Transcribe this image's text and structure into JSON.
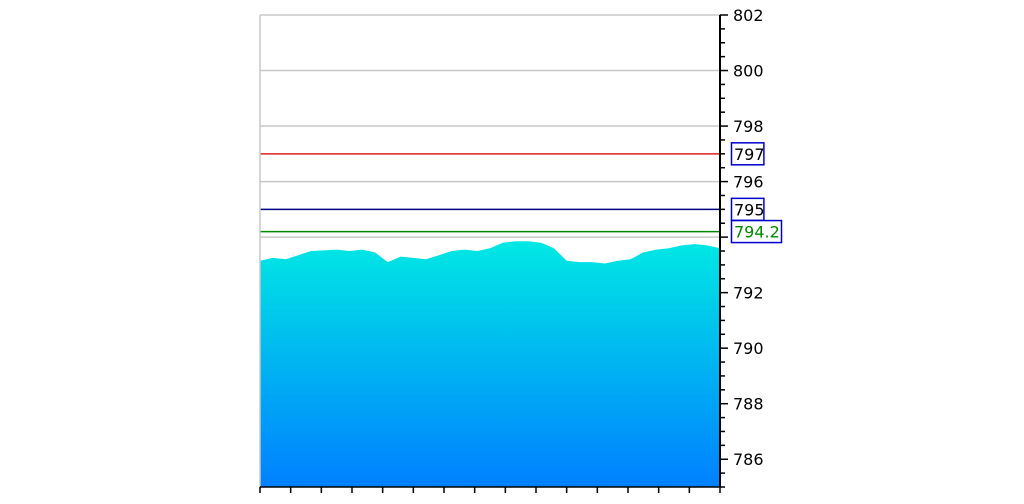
{
  "chart_data": {
    "type": "area",
    "title": "",
    "xlabel": "",
    "ylabel": "",
    "ylim": [
      785,
      802
    ],
    "y_ticks_major": [
      786,
      788,
      790,
      792,
      794,
      796,
      798,
      800,
      802
    ],
    "y_tick_labels_visible": [
      "786",
      "788",
      "790",
      "792",
      "796",
      "798",
      "800",
      "802"
    ],
    "y_minor_step": 0.5,
    "x_tick_count": 16,
    "grid": true,
    "y_axis_side": "right",
    "fill_gradient": {
      "top": "#00e8e4",
      "bottom": "#0080ff"
    },
    "series": [
      {
        "values": [
          793.15,
          793.25,
          793.2,
          793.35,
          793.5,
          793.52,
          793.55,
          793.5,
          793.55,
          793.45,
          793.1,
          793.3,
          793.25,
          793.2,
          793.35,
          793.5,
          793.55,
          793.5,
          793.6,
          793.8,
          793.85,
          793.85,
          793.8,
          793.6,
          793.15,
          793.1,
          793.1,
          793.05,
          793.15,
          793.2,
          793.45,
          793.55,
          793.6,
          793.7,
          793.75,
          793.7,
          793.6
        ]
      }
    ],
    "reference_lines": [
      {
        "value": 797,
        "label": "797",
        "color": "#e02020",
        "label_color": "#000000",
        "box_color": "#0000cc"
      },
      {
        "value": 795,
        "label": "795",
        "color": "#000080",
        "label_color": "#000000",
        "box_color": "#0000cc"
      },
      {
        "value": 794.2,
        "label": "794.2",
        "color": "#008800",
        "label_color": "#008800",
        "box_color": "#0000cc"
      }
    ]
  }
}
